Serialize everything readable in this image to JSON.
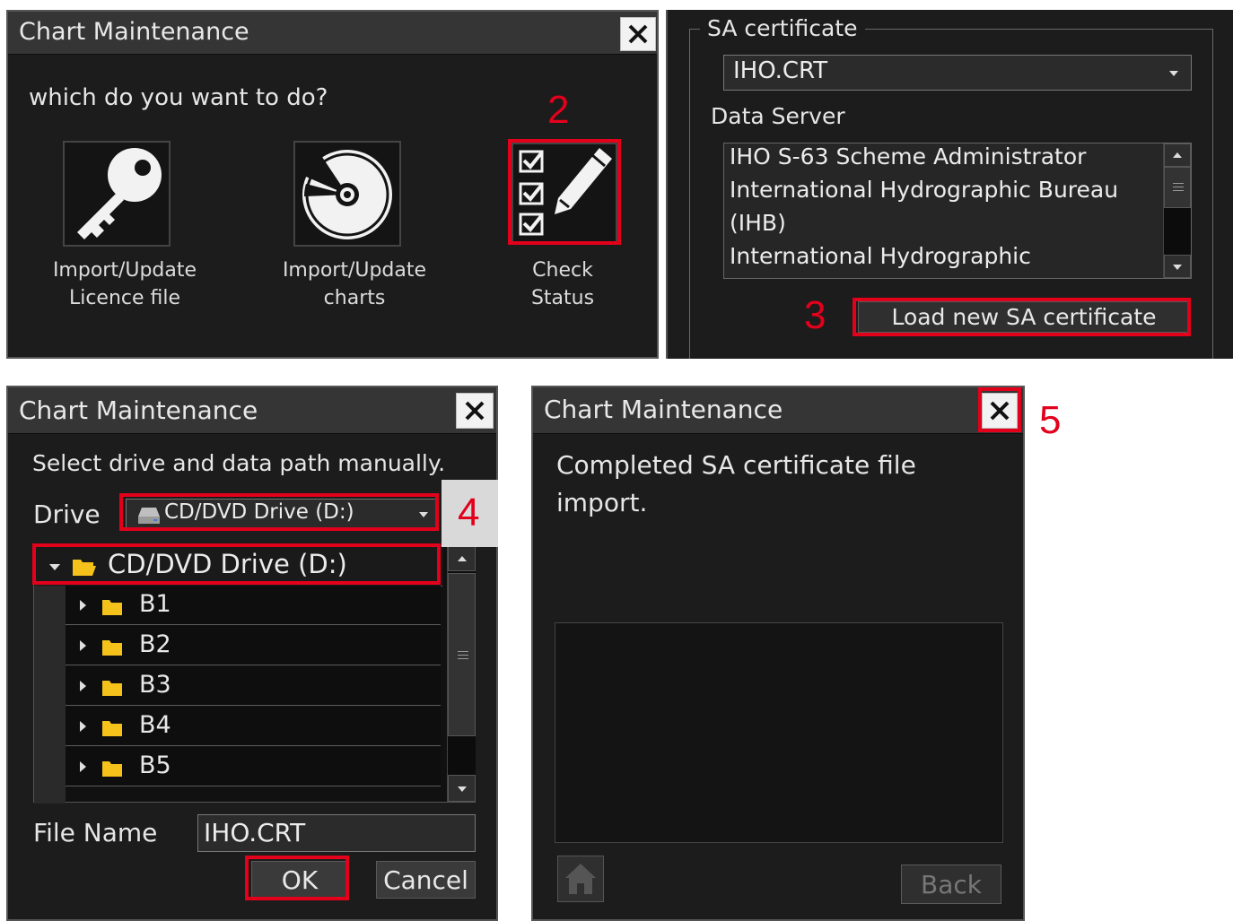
{
  "panel1": {
    "title": "Chart Maintenance",
    "prompt": "which do you want to do?",
    "options": [
      {
        "line1": "Import/Update",
        "line2": "Licence file",
        "icon": "key-icon"
      },
      {
        "line1": "Import/Update",
        "line2": "charts",
        "icon": "disc-icon"
      },
      {
        "line1": "Check",
        "line2": "Status",
        "icon": "checklist-pencil-icon"
      }
    ],
    "step_marker": "2"
  },
  "panel2": {
    "group_title": "SA certificate",
    "cert_value": "IHO.CRT",
    "data_server_label": "Data Server",
    "server_lines": [
      "IHO S-63 Scheme Administrator",
      "International Hydrographic Bureau",
      "(IHB)",
      "International Hydrographic"
    ],
    "load_button": "Load new SA certificate",
    "step_marker": "3"
  },
  "panel3": {
    "title": "Chart Maintenance",
    "instruction": "Select drive and data path manually.",
    "drive_label": "Drive",
    "drive_value": "CD/DVD Drive (D:)",
    "step_marker": "4",
    "tree_root": "CD/DVD Drive (D:)",
    "folders": [
      "B1",
      "B2",
      "B3",
      "B4",
      "B5"
    ],
    "file_name_label": "File Name",
    "file_name_value": "IHO.CRT",
    "ok_button": "OK",
    "cancel_button": "Cancel"
  },
  "panel4": {
    "title": "Chart Maintenance",
    "message_line1": "Completed SA certificate file",
    "message_line2": "import.",
    "back_button": "Back",
    "step_marker": "5"
  },
  "colors": {
    "annotation_red": "#e3001b",
    "panel_bg": "#1c1c1c",
    "titlebar_bg": "#353535",
    "folder_yellow": "#f5c21b"
  }
}
